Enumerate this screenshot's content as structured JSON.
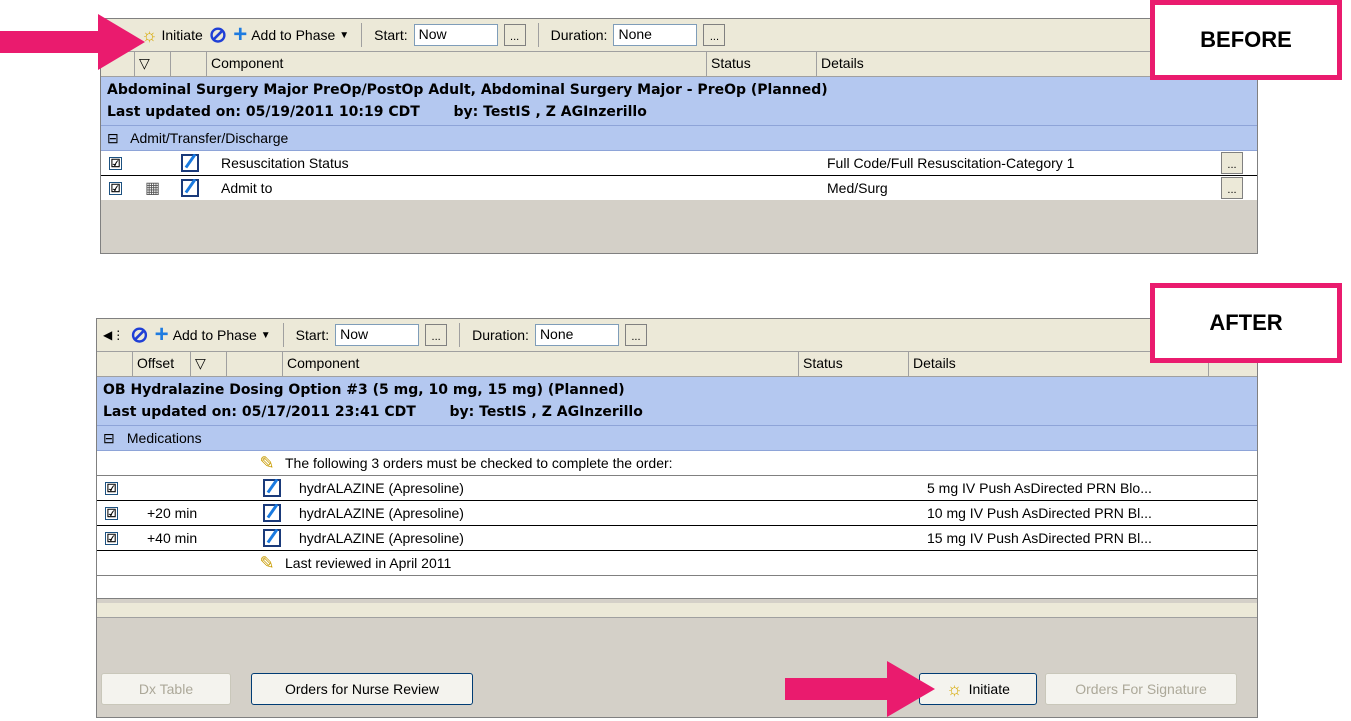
{
  "before": {
    "label": "BEFORE",
    "toolbar": {
      "initiate_label": "Initiate",
      "add_to_phase_label": "Add to Phase",
      "start_label": "Start:",
      "start_value": "Now",
      "duration_label": "Duration:",
      "duration_value": "None",
      "ellipsis": "..."
    },
    "columns": [
      "Component",
      "Status",
      "Details"
    ],
    "plan_title": "Abdominal Surgery Major PreOp/PostOp Adult, Abdominal Surgery Major - PreOp (Planned)",
    "last_updated": "Last updated on: 05/19/2011 10:19 CDT",
    "updated_by": "by: TestIS , Z AGInzerillo",
    "section": "Admit/Transfer/Discharge",
    "rows": [
      {
        "component": "Resuscitation Status",
        "details": "Full Code/Full Resuscitation-Category 1",
        "checked": true
      },
      {
        "component": "Admit to",
        "details": "Med/Surg",
        "checked": true
      }
    ]
  },
  "after": {
    "label": "AFTER",
    "toolbar": {
      "add_to_phase_label": "Add to Phase",
      "start_label": "Start:",
      "start_value": "Now",
      "duration_label": "Duration:",
      "duration_value": "None",
      "ellipsis": "..."
    },
    "columns": [
      "Offset",
      "Component",
      "Status",
      "Details"
    ],
    "plan_title": "OB Hydralazine Dosing Option #3 (5 mg, 10 mg, 15 mg) (Planned)",
    "last_updated": "Last updated on: 05/17/2011 23:41 CDT",
    "updated_by": "by: TestIS , Z AGInzerillo",
    "section": "Medications",
    "note_top": "The following 3 orders must be checked to complete the order:",
    "rows": [
      {
        "offset": "",
        "component": "hydrALAZINE (Apresoline)",
        "details": "5 mg IV Push AsDirected PRN Blo...",
        "checked": true
      },
      {
        "offset": "+20 min",
        "component": "hydrALAZINE (Apresoline)",
        "details": "10 mg IV Push AsDirected PRN Bl...",
        "checked": true
      },
      {
        "offset": "+40 min",
        "component": "hydrALAZINE (Apresoline)",
        "details": "15 mg IV Push AsDirected PRN Bl...",
        "checked": true
      }
    ],
    "note_bottom": "Last reviewed in April 2011",
    "buttons": {
      "dx_table": "Dx Table",
      "orders_nurse_review": "Orders for Nurse Review",
      "initiate": "Initiate",
      "orders_for_signature": "Orders For Signature"
    }
  },
  "checkmark": "☑",
  "colors": {
    "arrow": "#ea1b6e",
    "plan_header": "#b4c8f0",
    "label_border": "#ea1b6e"
  }
}
